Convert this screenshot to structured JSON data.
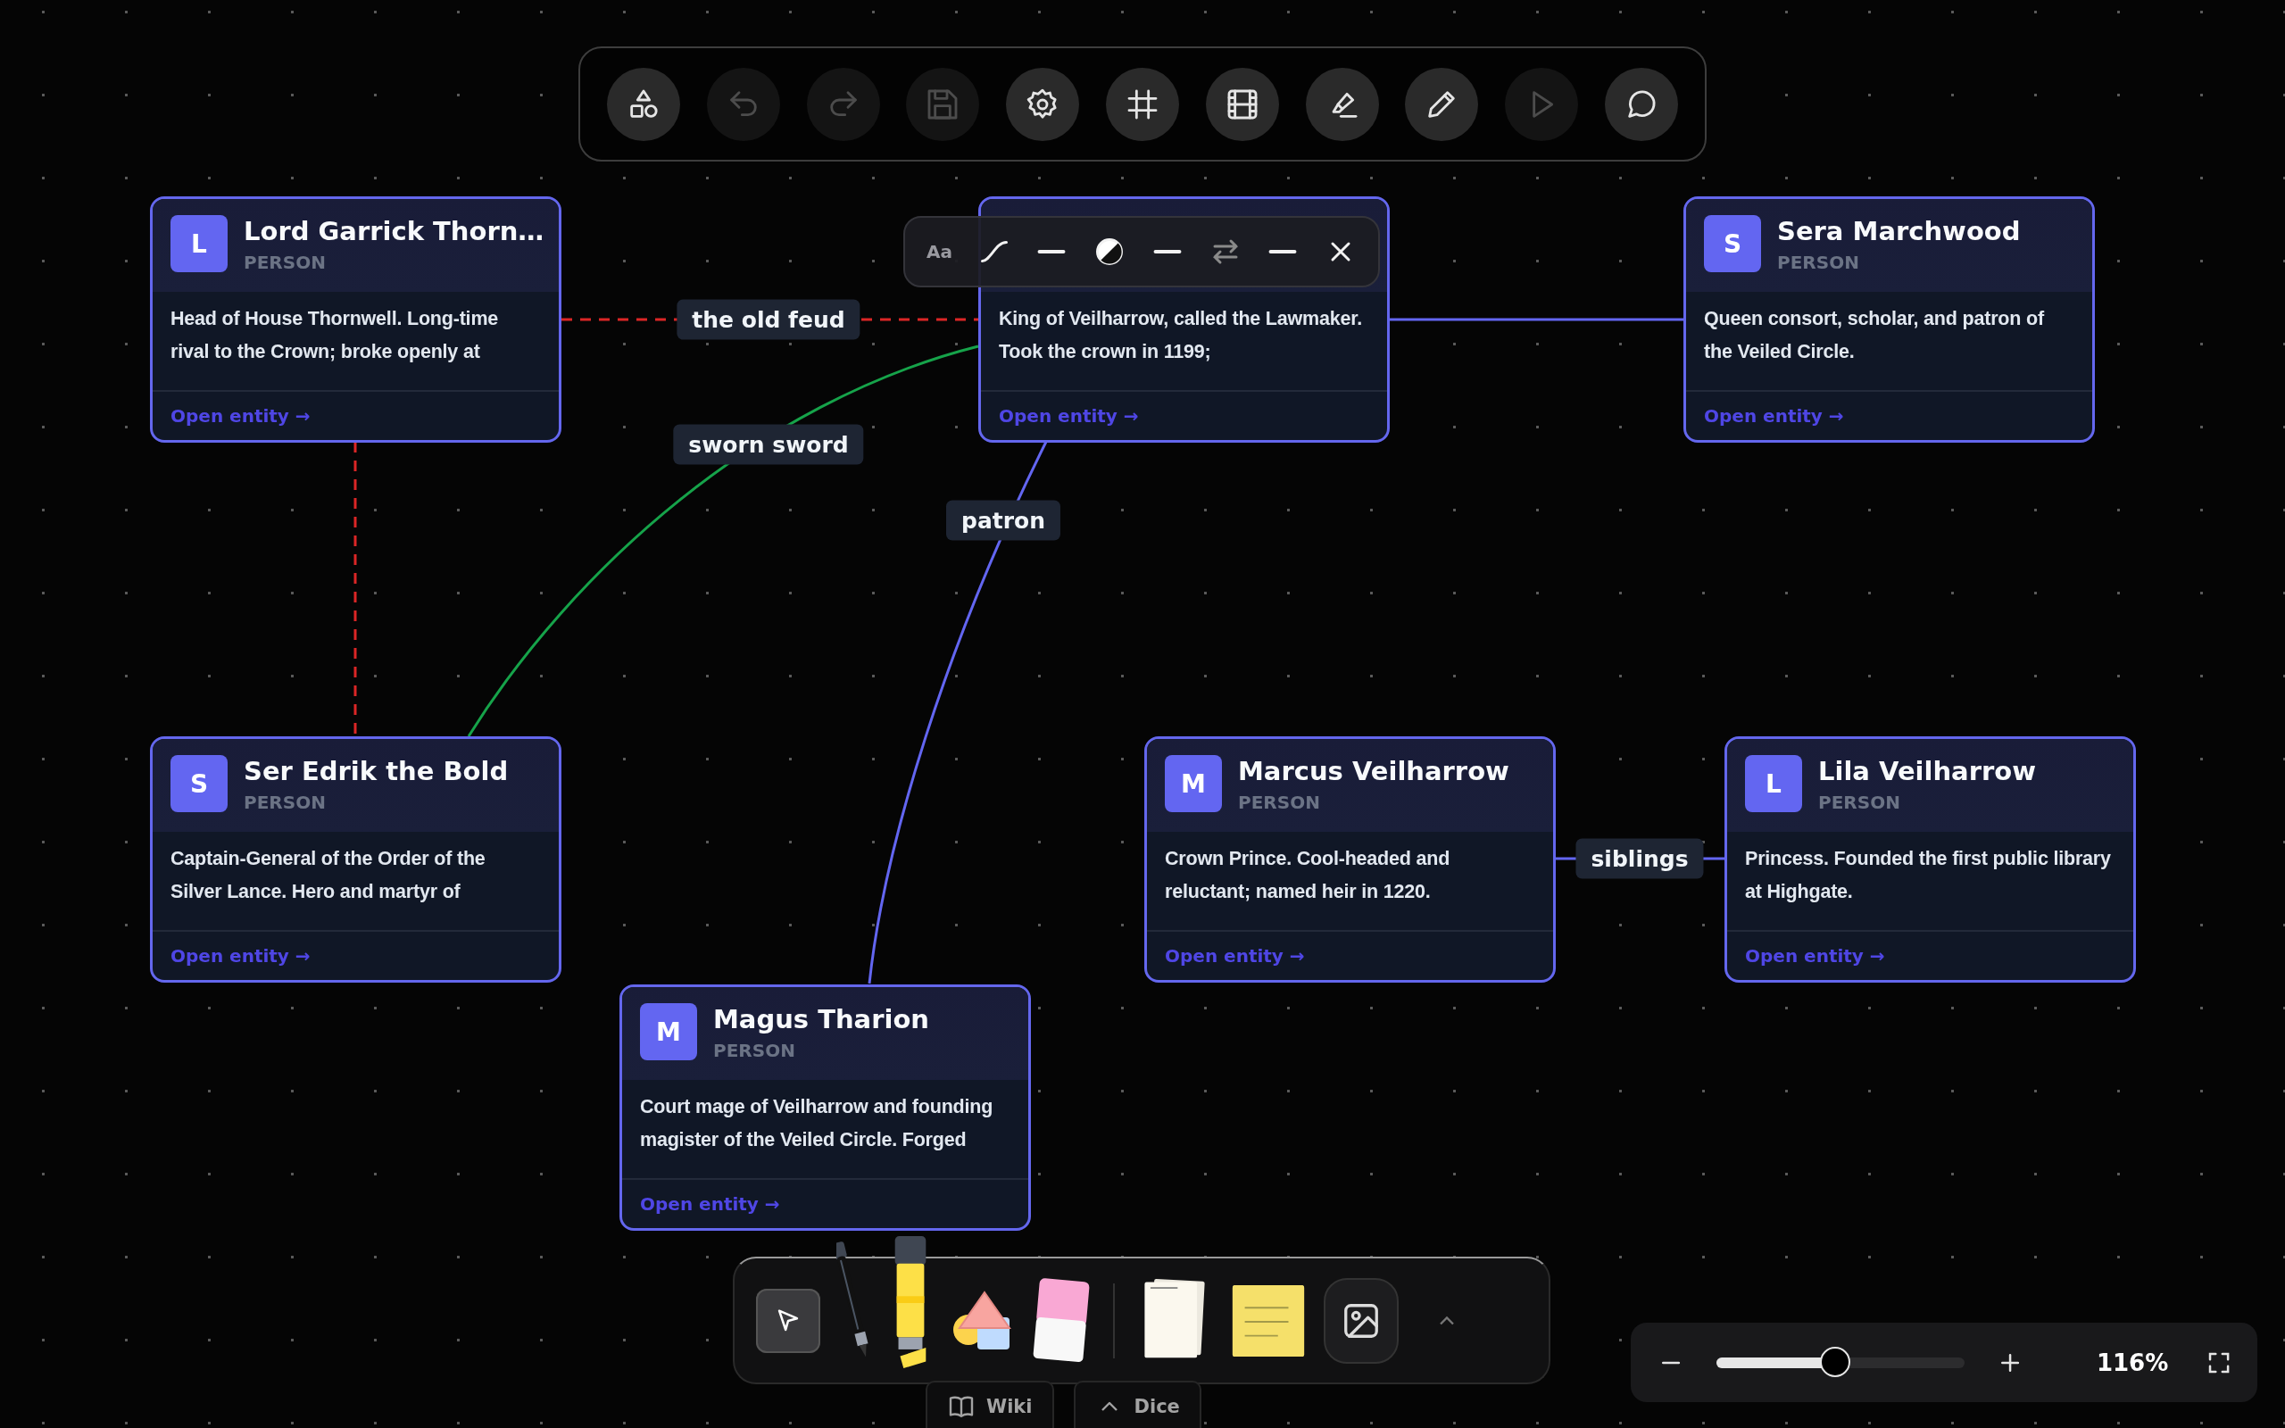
{
  "toolbar": {
    "buttons": [
      {
        "kind": "shapes",
        "disabled": false
      },
      {
        "kind": "undo",
        "disabled": true
      },
      {
        "kind": "redo",
        "disabled": true
      },
      {
        "kind": "save",
        "disabled": true
      },
      {
        "kind": "settings",
        "disabled": false
      },
      {
        "kind": "frame",
        "disabled": false
      },
      {
        "kind": "film",
        "disabled": false
      },
      {
        "kind": "highlight",
        "disabled": false
      },
      {
        "kind": "pencil",
        "disabled": false
      },
      {
        "kind": "play",
        "disabled": true
      },
      {
        "kind": "comment",
        "disabled": false
      }
    ]
  },
  "nodes": [
    {
      "avatar": "L",
      "name": "Lord Garrick Thorn…",
      "type": "PERSON",
      "description": "Head of House Thornwell. Long-time rival to the Crown; broke openly at",
      "link": "Open entity →"
    },
    {
      "description": "King of Veilharrow, called the Lawmaker. Took the crown in 1199;",
      "link": "Open entity →"
    },
    {
      "avatar": "S",
      "name": "Sera Marchwood",
      "type": "PERSON",
      "description": "Queen consort, scholar, and patron of the Veiled Circle.",
      "link": "Open entity →"
    },
    {
      "avatar": "S",
      "name": "Ser Edrik the Bold",
      "type": "PERSON",
      "description": "Captain-General of the Order of the Silver Lance. Hero and martyr of",
      "link": "Open entity →"
    },
    {
      "avatar": "M",
      "name": "Marcus Veilharrow",
      "type": "PERSON",
      "description": "Crown Prince. Cool-headed and reluctant; named heir in 1220.",
      "link": "Open entity →"
    },
    {
      "avatar": "L",
      "name": "Lila Veilharrow",
      "type": "PERSON",
      "description": "Princess. Founded the first public library at Highgate.",
      "link": "Open entity →"
    },
    {
      "avatar": "M",
      "name": "Magus Tharion",
      "type": "PERSON",
      "description": "Court mage of Veilharrow and founding magister of the Veiled Circle. Forged",
      "link": "Open entity →"
    }
  ],
  "edges": [
    {
      "label": "the old feud",
      "color": "#dc2626",
      "kind": "dashed"
    },
    {
      "color": "#dc2626",
      "kind": "dashed"
    },
    {
      "label": "sworn sword",
      "color": "#16a34a",
      "kind": "solid"
    },
    {
      "label": "patron",
      "color": "#6366f1",
      "kind": "solid"
    },
    {
      "color": "#6366f1",
      "kind": "solid"
    },
    {
      "label": "siblings",
      "color": "#6366f1",
      "kind": "solid"
    }
  ],
  "edge_toolbar": {
    "font_button": "Aa",
    "items": [
      {
        "kind": "curve"
      },
      {
        "kind": "line"
      },
      {
        "kind": "contrast"
      },
      {
        "kind": "line"
      },
      {
        "kind": "swap"
      },
      {
        "kind": "line"
      },
      {
        "kind": "close"
      }
    ]
  },
  "bottom_toolbar": {
    "tools": [
      {
        "kind": "select",
        "selected": true
      },
      {
        "kind": "pen",
        "selected": false
      },
      {
        "kind": "highlighter",
        "selected": false
      },
      {
        "kind": "shapes",
        "selected": false
      },
      {
        "kind": "eraser",
        "selected": false
      }
    ],
    "inserts": [
      {
        "kind": "paper"
      },
      {
        "kind": "sticky"
      },
      {
        "kind": "image"
      },
      {
        "kind": "expand"
      }
    ]
  },
  "tabs": [
    {
      "kind": "book",
      "label": "Wiki"
    },
    {
      "kind": "chevron",
      "label": "Dice"
    }
  ],
  "zoom": {
    "level": 0.45,
    "reading": "116%"
  }
}
